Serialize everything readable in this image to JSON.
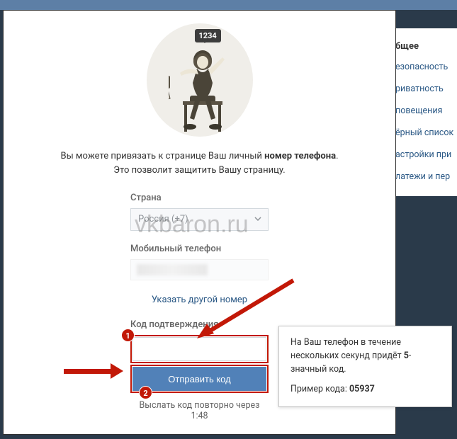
{
  "sidebar": {
    "title": "бщее",
    "items": [
      "езопасность",
      "риватность",
      "повещения",
      "ёрный список",
      "астройки при",
      "латежи и пер"
    ]
  },
  "illustration": {
    "bubble": "1234"
  },
  "description": {
    "line1_pre": "Вы можете привязать к странице Ваш личный ",
    "line1_bold": "номер телефона",
    "line1_post": ".",
    "line2": "Это позволит защитить Вашу страницу."
  },
  "form": {
    "country_label": "Страна",
    "country_value": "Россия (+7)",
    "phone_label": "Мобильный телефон",
    "other_number_link": "Указать другой номер",
    "code_label": "Код подтверждения",
    "submit": "Отправить код",
    "resend_pre": "Выслать код повторно через ",
    "resend_time": "1:48"
  },
  "badges": {
    "b1": "1",
    "b2": "2"
  },
  "tooltip": {
    "p1_pre": "На Ваш телефон в течение нескольких секунд придёт ",
    "p1_bold": "5",
    "p1_post": "-значный код.",
    "p2_pre": "Пример кода: ",
    "p2_bold": "05937"
  },
  "watermark": "vkbaron.ru"
}
